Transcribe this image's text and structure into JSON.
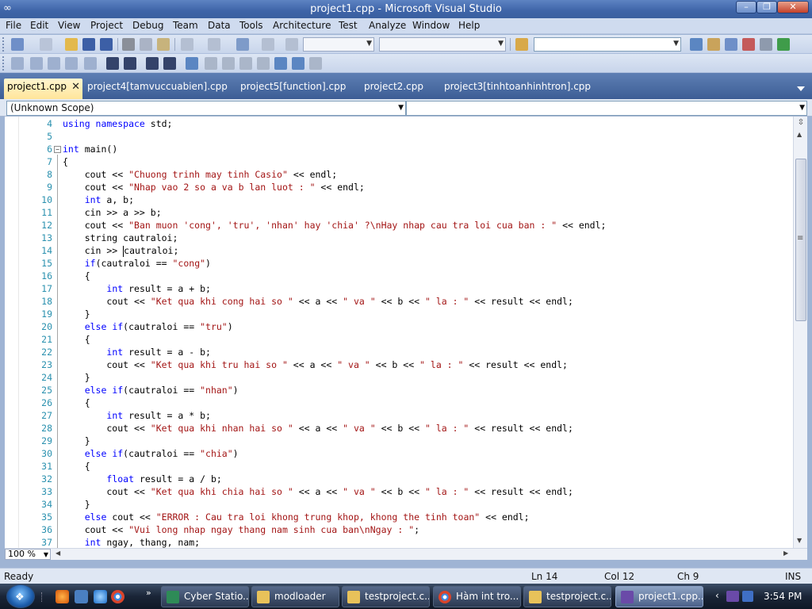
{
  "window": {
    "title": "project1.cpp - Microsoft Visual Studio"
  },
  "menu": [
    "File",
    "Edit",
    "View",
    "Project",
    "Debug",
    "Team",
    "Data",
    "Tools",
    "Architecture",
    "Test",
    "Analyze",
    "Window",
    "Help"
  ],
  "tabs": [
    {
      "label": "project1.cpp",
      "active": true
    },
    {
      "label": "project4[tamvuccuabien].cpp"
    },
    {
      "label": "project5[function].cpp"
    },
    {
      "label": "project2.cpp"
    },
    {
      "label": "project3[tinhtoanhinhtron].cpp"
    }
  ],
  "scope": {
    "left": "(Unknown Scope)",
    "right": ""
  },
  "editor": {
    "zoom": "100 %",
    "lines": [
      {
        "n": "4",
        "parts": [
          [
            "kw",
            "using namespace"
          ],
          [
            "t",
            " std;"
          ]
        ]
      },
      {
        "n": "5",
        "parts": []
      },
      {
        "n": "6",
        "parts": [
          [
            "kw",
            "int"
          ],
          [
            "t",
            " main()"
          ]
        ]
      },
      {
        "n": "7",
        "parts": [
          [
            "t",
            "{"
          ]
        ]
      },
      {
        "n": "8",
        "parts": [
          [
            "t",
            "    cout << "
          ],
          [
            "str",
            "\"Chuong trinh may tinh Casio\""
          ],
          [
            "t",
            " << endl;"
          ]
        ]
      },
      {
        "n": "9",
        "parts": [
          [
            "t",
            "    cout << "
          ],
          [
            "str",
            "\"Nhap vao 2 so a va b lan luot : \""
          ],
          [
            "t",
            " << endl;"
          ]
        ]
      },
      {
        "n": "10",
        "parts": [
          [
            "t",
            "    "
          ],
          [
            "kw",
            "int"
          ],
          [
            "t",
            " a, b;"
          ]
        ]
      },
      {
        "n": "11",
        "parts": [
          [
            "t",
            "    cin >> a >> b;"
          ]
        ]
      },
      {
        "n": "12",
        "parts": [
          [
            "t",
            "    cout << "
          ],
          [
            "str",
            "\"Ban muon 'cong', 'tru', 'nhan' hay 'chia' ?\\nHay nhap cau tra loi cua ban : \""
          ],
          [
            "t",
            " << endl;"
          ]
        ]
      },
      {
        "n": "13",
        "parts": [
          [
            "t",
            "    string cautraloi;"
          ]
        ]
      },
      {
        "n": "14",
        "parts": [
          [
            "t",
            "    cin >> "
          ],
          [
            "caret",
            ""
          ],
          [
            "t",
            "cautraloi;"
          ]
        ]
      },
      {
        "n": "15",
        "parts": [
          [
            "t",
            "    "
          ],
          [
            "kw",
            "if"
          ],
          [
            "t",
            "(cautraloi == "
          ],
          [
            "str",
            "\"cong\""
          ],
          [
            "t",
            ")"
          ]
        ]
      },
      {
        "n": "16",
        "parts": [
          [
            "t",
            "    {"
          ]
        ]
      },
      {
        "n": "17",
        "parts": [
          [
            "t",
            "        "
          ],
          [
            "kw",
            "int"
          ],
          [
            "t",
            " result = a + b;"
          ]
        ]
      },
      {
        "n": "18",
        "parts": [
          [
            "t",
            "        cout << "
          ],
          [
            "str",
            "\"Ket qua khi cong hai so \""
          ],
          [
            "t",
            " << a << "
          ],
          [
            "str",
            "\" va \""
          ],
          [
            "t",
            " << b << "
          ],
          [
            "str",
            "\" la : \""
          ],
          [
            "t",
            " << result << endl;"
          ]
        ]
      },
      {
        "n": "19",
        "parts": [
          [
            "t",
            "    }"
          ]
        ]
      },
      {
        "n": "20",
        "parts": [
          [
            "t",
            "    "
          ],
          [
            "kw",
            "else if"
          ],
          [
            "t",
            "(cautraloi == "
          ],
          [
            "str",
            "\"tru\""
          ],
          [
            "t",
            ")"
          ]
        ]
      },
      {
        "n": "21",
        "parts": [
          [
            "t",
            "    {"
          ]
        ]
      },
      {
        "n": "22",
        "parts": [
          [
            "t",
            "        "
          ],
          [
            "kw",
            "int"
          ],
          [
            "t",
            " result = a - b;"
          ]
        ]
      },
      {
        "n": "23",
        "parts": [
          [
            "t",
            "        cout << "
          ],
          [
            "str",
            "\"Ket qua khi tru hai so \""
          ],
          [
            "t",
            " << a << "
          ],
          [
            "str",
            "\" va \""
          ],
          [
            "t",
            " << b << "
          ],
          [
            "str",
            "\" la : \""
          ],
          [
            "t",
            " << result << endl;"
          ]
        ]
      },
      {
        "n": "24",
        "parts": [
          [
            "t",
            "    }"
          ]
        ]
      },
      {
        "n": "25",
        "parts": [
          [
            "t",
            "    "
          ],
          [
            "kw",
            "else if"
          ],
          [
            "t",
            "(cautraloi == "
          ],
          [
            "str",
            "\"nhan\""
          ],
          [
            "t",
            ")"
          ]
        ]
      },
      {
        "n": "26",
        "parts": [
          [
            "t",
            "    {"
          ]
        ]
      },
      {
        "n": "27",
        "parts": [
          [
            "t",
            "        "
          ],
          [
            "kw",
            "int"
          ],
          [
            "t",
            " result = a * b;"
          ]
        ]
      },
      {
        "n": "28",
        "parts": [
          [
            "t",
            "        cout << "
          ],
          [
            "str",
            "\"Ket qua khi nhan hai so \""
          ],
          [
            "t",
            " << a << "
          ],
          [
            "str",
            "\" va \""
          ],
          [
            "t",
            " << b << "
          ],
          [
            "str",
            "\" la : \""
          ],
          [
            "t",
            " << result << endl;"
          ]
        ]
      },
      {
        "n": "29",
        "parts": [
          [
            "t",
            "    }"
          ]
        ]
      },
      {
        "n": "30",
        "parts": [
          [
            "t",
            "    "
          ],
          [
            "kw",
            "else if"
          ],
          [
            "t",
            "(cautraloi == "
          ],
          [
            "str",
            "\"chia\""
          ],
          [
            "t",
            ")"
          ]
        ]
      },
      {
        "n": "31",
        "parts": [
          [
            "t",
            "    {"
          ]
        ]
      },
      {
        "n": "32",
        "parts": [
          [
            "t",
            "        "
          ],
          [
            "kw",
            "float"
          ],
          [
            "t",
            " result = a / b;"
          ]
        ]
      },
      {
        "n": "33",
        "parts": [
          [
            "t",
            "        cout << "
          ],
          [
            "str",
            "\"Ket qua khi chia hai so \""
          ],
          [
            "t",
            " << a << "
          ],
          [
            "str",
            "\" va \""
          ],
          [
            "t",
            " << b << "
          ],
          [
            "str",
            "\" la : \""
          ],
          [
            "t",
            " << result << endl;"
          ]
        ]
      },
      {
        "n": "34",
        "parts": [
          [
            "t",
            "    }"
          ]
        ]
      },
      {
        "n": "35",
        "parts": [
          [
            "t",
            "    "
          ],
          [
            "kw",
            "else"
          ],
          [
            "t",
            " cout << "
          ],
          [
            "str",
            "\"ERROR : Cau tra loi khong trung khop, khong the tinh toan\""
          ],
          [
            "t",
            " << endl;"
          ]
        ]
      },
      {
        "n": "36",
        "parts": [
          [
            "t",
            "    cout << "
          ],
          [
            "str",
            "\"Vui long nhap ngay thang nam sinh cua ban\\nNgay : \""
          ],
          [
            "t",
            ";"
          ]
        ]
      },
      {
        "n": "37",
        "parts": [
          [
            "t",
            "    "
          ],
          [
            "kw",
            "int"
          ],
          [
            "t",
            " ngay, thang, nam;"
          ]
        ]
      }
    ]
  },
  "status": {
    "ready": "Ready",
    "ln": "Ln 14",
    "col": "Col 12",
    "ch": "Ch 9",
    "ins": "INS"
  },
  "taskbar": {
    "items": [
      {
        "label": "Cyber Statio...",
        "icon": "cyber-station-icon",
        "color": "#2e8b57"
      },
      {
        "label": "modloader",
        "icon": "folder-icon",
        "color": "#e8c25a"
      },
      {
        "label": "testproject.c...",
        "icon": "folder-icon",
        "color": "#e8c25a"
      },
      {
        "label": "Hàm int tro...",
        "icon": "chrome-icon",
        "color": "#d9442b"
      },
      {
        "label": "testproject.c...",
        "icon": "folder-icon",
        "color": "#e8c25a"
      },
      {
        "label": "project1.cpp...",
        "icon": "visual-studio-icon",
        "color": "#6a4aa8",
        "active": true
      }
    ],
    "clock": "3:54 PM"
  },
  "colors": {
    "keyword": "#0000ff",
    "string": "#a31515",
    "line_number": "#2b91af",
    "tab_active": "#ffe59a"
  }
}
